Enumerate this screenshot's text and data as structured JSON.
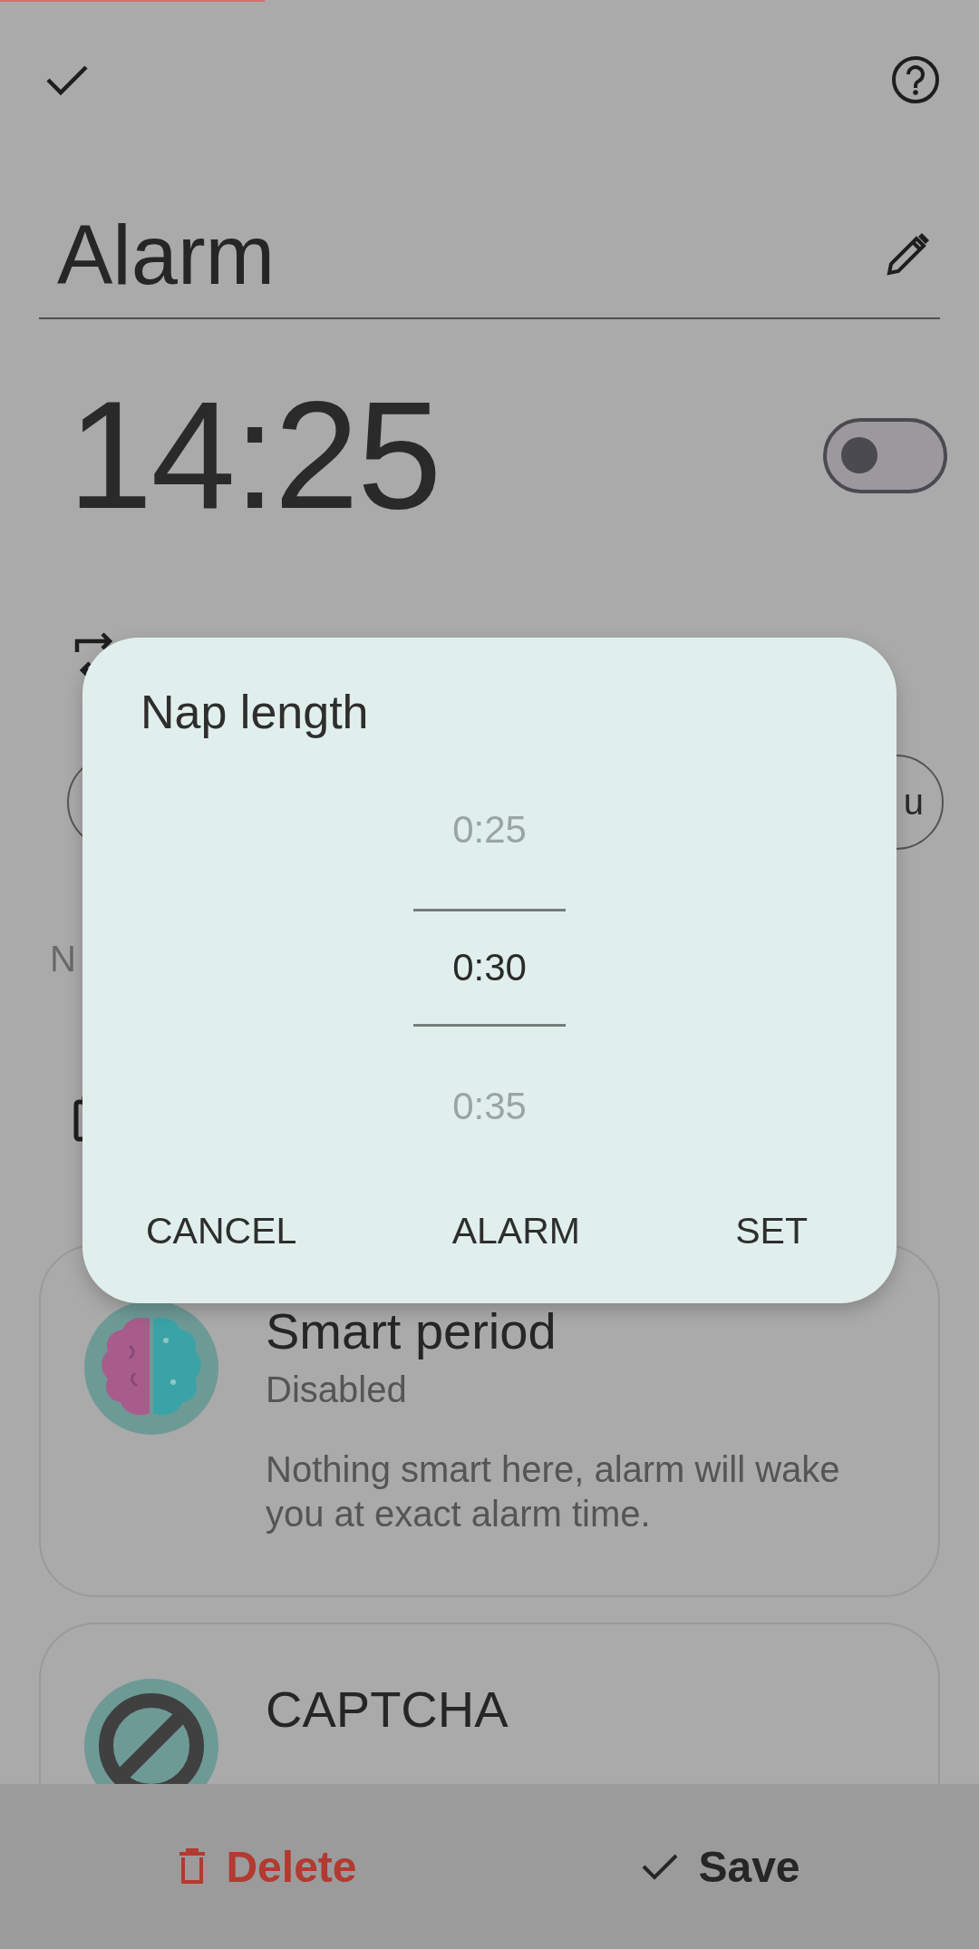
{
  "title": "Alarm",
  "time": "14:25",
  "enabled": false,
  "behind_dialog": {
    "chip_text": "u",
    "label_text": "N"
  },
  "dialog": {
    "title": "Nap length",
    "picker": [
      {
        "label": "0:25",
        "selected": false
      },
      {
        "label": "0:30",
        "selected": true
      },
      {
        "label": "0:35",
        "selected": false
      }
    ],
    "buttons": [
      "CANCEL",
      "ALARM",
      "SET"
    ]
  },
  "cards": [
    {
      "kind": "brain",
      "title": "Smart period",
      "status": "Disabled",
      "description": "Nothing smart here, alarm will wake you at exact alarm time."
    },
    {
      "kind": "blocked",
      "title": "CAPTCHA"
    }
  ],
  "bottom_bar": {
    "delete": "Delete",
    "save": "Save"
  }
}
